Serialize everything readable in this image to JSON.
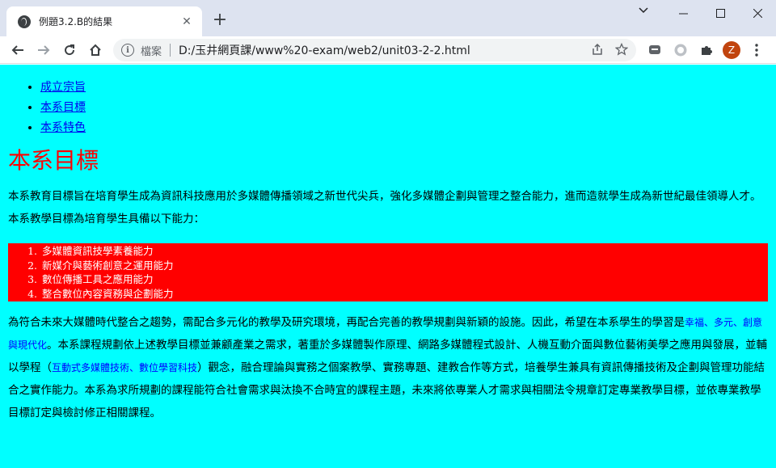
{
  "browser": {
    "tab_title": "例題3.2.B的結果",
    "tab_close": "✕",
    "new_tab": "+",
    "window_controls": {
      "minimize": "—",
      "maximize": "☐",
      "close": "✕"
    },
    "address": {
      "label": "檔案",
      "url": "D:/玉井網頁課/www%20-exam/web2/unit03-2-2.html"
    },
    "profile_initial": "Z"
  },
  "page": {
    "nav": [
      "成立宗旨",
      "本系目標",
      "本系特色"
    ],
    "heading": "本系目標",
    "intro": "本系教育目標旨在培育學生成為資訊科技應用於多媒體傳播領域之新世代尖兵，強化多媒體企劃與管理之整合能力，進而造就學生成為新世紀最佳領導人才。本系教學目標為培育學生具備以下能力：",
    "abilities": [
      "多媒體資訊技學素養能力",
      "新媒介與藝術創意之運用能力",
      "數位傳播工具之應用能力",
      "整合數位內容資務與企劃能力"
    ],
    "detail": {
      "part1": "為符合未來大媒體時代整合之趨勢，需配合多元化的教學及研究環境，再配合完善的教學規劃與新穎的設施。因此，希望在本系學生的學習是",
      "highlight1": "幸福、多元、創意與現代化",
      "part2": "。本系課程規劃依上述教學目標並兼顧產業之需求，著重於多媒體製作原理、網路多媒體程式設計、人機互動介面與數位藝術美學之應用與發展，並輔以學程（",
      "highlight2": "互動式多媒體技術、數位學習科技",
      "part3": "）觀念，融合理論與實務之個案教學、實務專題、建教合作等方式，培養學生兼具有資訊傳播技術及企劃與管理功能結合之實作能力。本系為求所規劃的課程能符合社會需求與汰換不合時宜的課程主題，未來將依專業人才需求與相關法令規章訂定專業教學目標，並依專業教學目標訂定與檢討修正相關課程。"
    }
  },
  "colors": {
    "page_background": "#00ffff",
    "heading": "#ff0000",
    "ability_box": "#ff0000",
    "highlight": "#0000ff",
    "link": "#0000ee"
  }
}
